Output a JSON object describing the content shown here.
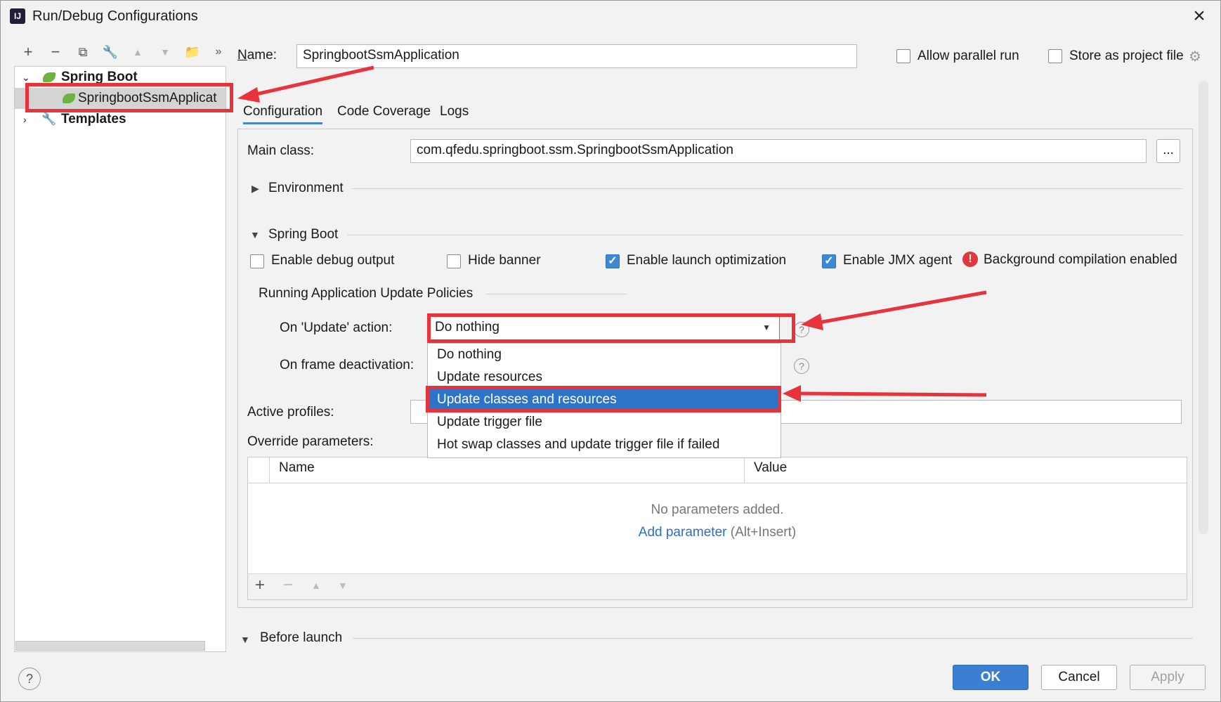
{
  "window": {
    "title": "Run/Debug Configurations"
  },
  "tree": {
    "spring_boot": "Spring Boot",
    "app": "SpringbootSsmApplicat",
    "templates": "Templates"
  },
  "name_label": "Name:",
  "name_value": "SpringbootSsmApplication",
  "allow_parallel": "Allow parallel run",
  "store_project": "Store as project file",
  "tabs": [
    "Configuration",
    "Code Coverage",
    "Logs"
  ],
  "main_class_label": "Main class:",
  "main_class_value": "com.qfedu.springboot.ssm.SpringbootSsmApplication",
  "browse": "...",
  "environment": "Environment",
  "spring_boot_section": "Spring Boot",
  "checkboxes": [
    {
      "label": "Enable debug output",
      "checked": false
    },
    {
      "label": "Hide banner",
      "checked": false
    },
    {
      "label": "Enable launch optimization",
      "checked": true
    },
    {
      "label": "Enable JMX agent",
      "checked": true
    }
  ],
  "bg_compilation": "Background compilation enabled",
  "update_policies": "Running Application Update Policies",
  "on_update_label": "On 'Update' action:",
  "on_update_value": "Do nothing",
  "on_frame_label": "On frame deactivation:",
  "dropdown_options": [
    "Do nothing",
    "Update resources",
    "Update classes and resources",
    "Update trigger file",
    "Hot swap classes and update trigger file if failed"
  ],
  "active_profiles_label": "Active profiles:",
  "override_label": "Override parameters:",
  "table": {
    "col_name": "Name",
    "col_value": "Value",
    "empty": "No parameters added.",
    "add_link": "Add parameter",
    "shortcut": "(Alt+Insert)"
  },
  "before_launch": "Before launch",
  "buttons": {
    "ok": "OK",
    "cancel": "Cancel",
    "apply": "Apply"
  },
  "help": "?",
  "colors": {
    "highlight": "#e8323c",
    "selection": "#2c74c8",
    "primary": "#3a7fd1"
  }
}
